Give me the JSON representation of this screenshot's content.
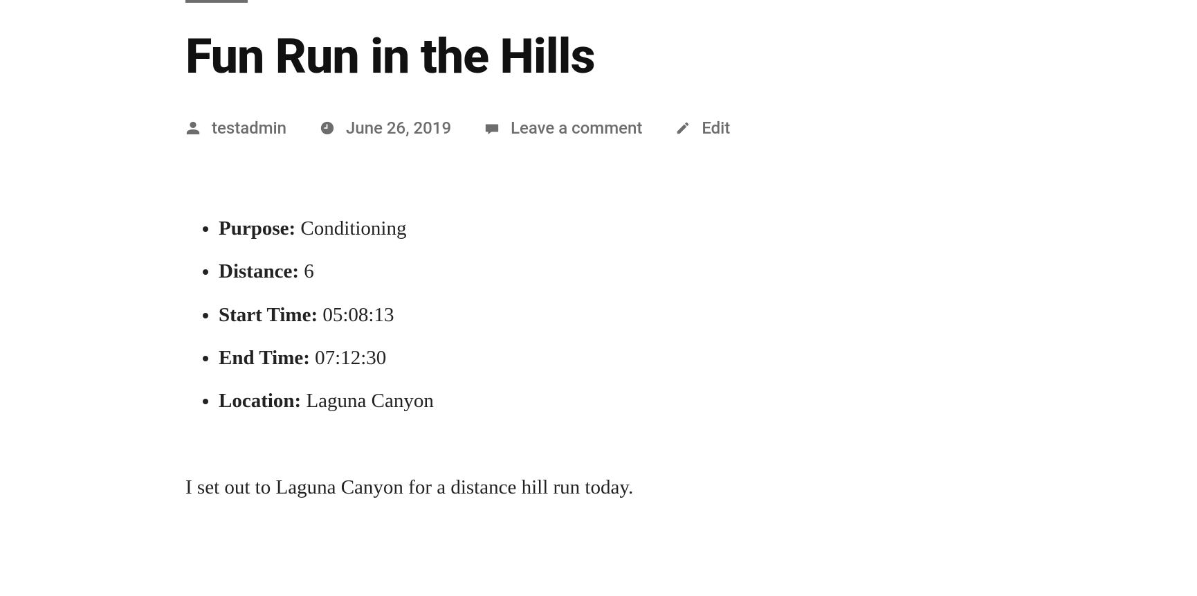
{
  "post": {
    "title": "Fun Run in the Hills",
    "meta": {
      "author": "testadmin",
      "date": "June 26, 2019",
      "comments_link": "Leave a comment",
      "edit_link": "Edit"
    },
    "details": [
      {
        "label": "Purpose:",
        "value": "Conditioning"
      },
      {
        "label": "Distance:",
        "value": "6"
      },
      {
        "label": "Start Time:",
        "value": "05:08:13"
      },
      {
        "label": "End Time:",
        "value": "07:12:30"
      },
      {
        "label": "Location:",
        "value": "Laguna Canyon"
      }
    ],
    "body": "I set out to Laguna Canyon for a distance hill run today."
  }
}
